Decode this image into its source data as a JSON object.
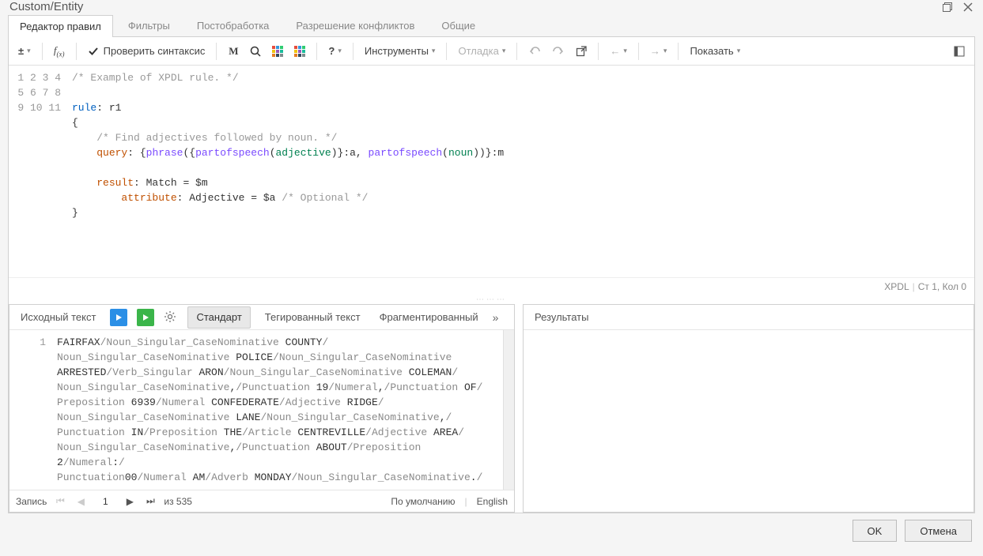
{
  "window": {
    "title": "Custom/Entity"
  },
  "tabs": {
    "items": [
      {
        "label": "Редактор правил",
        "active": true
      },
      {
        "label": "Фильтры"
      },
      {
        "label": "Постобработка"
      },
      {
        "label": "Разрешение конфликтов"
      },
      {
        "label": "Общие"
      }
    ]
  },
  "toolbar": {
    "check_syntax": "Проверить синтаксис",
    "tools": "Инструменты",
    "debug": "Отладка",
    "show": "Показать"
  },
  "editor": {
    "lines": [
      "1",
      "2",
      "3",
      "4",
      "5",
      "6",
      "7",
      "8",
      "9",
      "10",
      "11"
    ],
    "code_html": "<span class='c-com'>/* Example of XPDL rule. */</span>\n\n<span class='c-kw'>rule</span>: r1\n{\n    <span class='c-com'>/* Find adjectives followed by noun. */</span>\n    <span class='c-q'>query</span>: {<span class='c-fn'>phrase</span>({<span class='c-fn'>partofspeech</span>(<span class='c-arg'>adjective</span>)}:a, <span class='c-fn'>partofspeech</span>(<span class='c-arg'>noun</span>))}:m\n\n    <span class='c-q'>result</span>: Match = $m\n        <span class='c-q'>attribute</span>: Adjective = $a <span class='c-com'>/* Optional */</span>\n}\n"
  },
  "status": {
    "lang": "XPDL",
    "pos": "Ст 1, Кол 0"
  },
  "lower_tabs": {
    "source_text": "Исходный текст",
    "standard": "Стандарт",
    "tagged": "Тегированный текст",
    "fragmented": "Фрагментированный",
    "results": "Результаты"
  },
  "tagged": {
    "line": "1",
    "html": "<span class='w'>FAIRFAX</span><span class='t'>/Noun_Singular_CaseNominative</span> <span class='w'>COUNTY</span><span class='t'>/</span>\n<span class='t'>Noun_Singular_CaseNominative</span> <span class='w'>POLICE</span><span class='t'>/Noun_Singular_CaseNominative</span>\n<span class='w'>ARRESTED</span><span class='t'>/Verb_Singular</span> <span class='w'>ARON</span><span class='t'>/Noun_Singular_CaseNominative</span> <span class='w'>COLEMAN</span><span class='t'>/</span>\n<span class='t'>Noun_Singular_CaseNominative</span><span class='w'>,</span><span class='t'>/Punctuation</span> <span class='w'>19</span><span class='t'>/Numeral</span><span class='w'>,</span><span class='t'>/Punctuation</span> <span class='w'>OF</span><span class='t'>/</span>\n<span class='t'>Preposition</span> <span class='w'>6939</span><span class='t'>/Numeral</span> <span class='w'>CONFEDERATE</span><span class='t'>/Adjective</span> <span class='w'>RIDGE</span><span class='t'>/</span>\n<span class='t'>Noun_Singular_CaseNominative</span> <span class='w'>LANE</span><span class='t'>/Noun_Singular_CaseNominative</span><span class='w'>,</span><span class='t'>/</span>\n<span class='t'>Punctuation</span> <span class='w'>IN</span><span class='t'>/Preposition</span> <span class='w'>THE</span><span class='t'>/Article</span> <span class='w'>CENTREVILLE</span><span class='t'>/Adjective</span> <span class='w'>AREA</span><span class='t'>/</span>\n<span class='t'>Noun_Singular_CaseNominative</span><span class='w'>,</span><span class='t'>/Punctuation</span> <span class='w'>ABOUT</span><span class='t'>/Preposition</span> <span class='w'>2</span><span class='t'>/Numeral</span><span class='w'>:</span><span class='t'>/</span>\n<span class='t'>Punctuation</span><span class='w'>00</span><span class='t'>/Numeral</span> <span class='w'>AM</span><span class='t'>/Adverb</span> <span class='w'>MONDAY</span><span class='t'>/Noun_Singular_CaseNominative</span><span class='w'>.</span><span class='t'>/</span>"
  },
  "nav": {
    "record": "Запись",
    "page": "1",
    "of": "из 535",
    "default": "По умолчанию",
    "english": "English"
  },
  "footer": {
    "ok": "OK",
    "cancel": "Отмена"
  }
}
